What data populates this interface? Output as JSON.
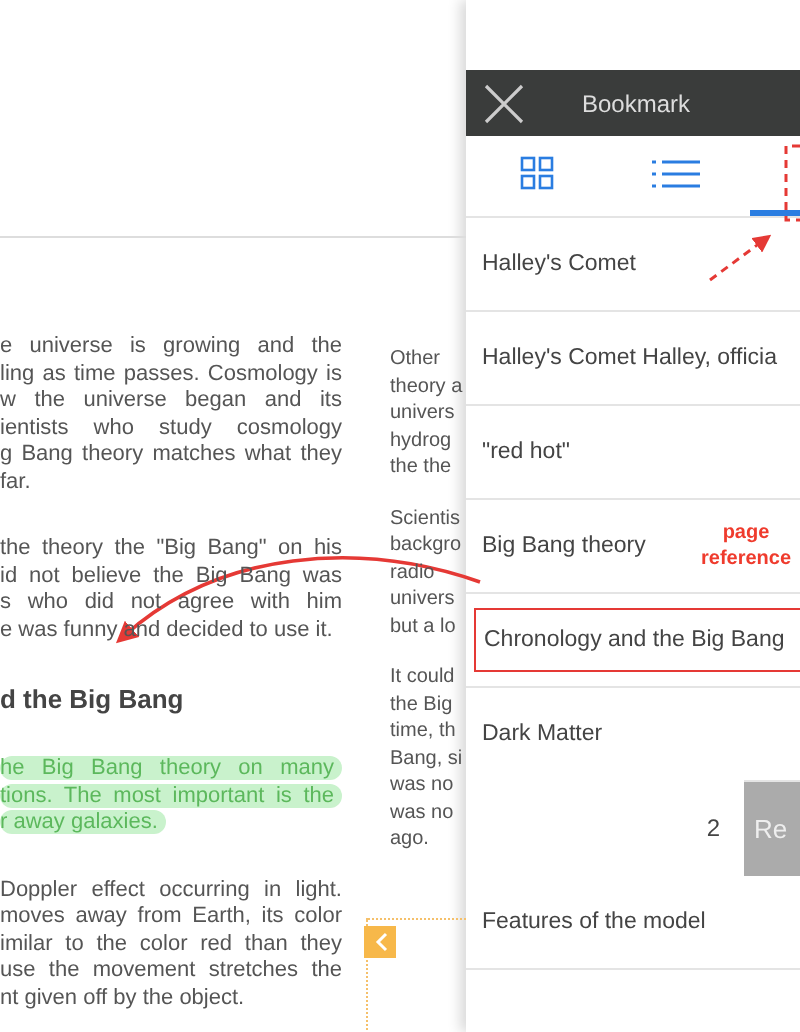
{
  "reader": {
    "columns": [
      {
        "blocks": [
          {
            "kind": "paragraph",
            "lines": [
              "e universe is growing and the",
              "ling as time passes. Cosmology is",
              "w the universe began and its",
              "ientists who study cosmology",
              "g Bang theory matches what they",
              "far."
            ]
          },
          {
            "kind": "paragraph",
            "lines": [
              "the theory the \"Big Bang\" on his",
              "id not believe the Big Bang was",
              "s who did not agree with him",
              "e was funny and decided to use it."
            ]
          },
          {
            "kind": "heading",
            "lines": [
              "d the Big Bang"
            ]
          },
          {
            "kind": "highlight",
            "lines": [
              "he Big Bang theory on many",
              "tions. The most important is the",
              "r away galaxies."
            ]
          },
          {
            "kind": "paragraph",
            "lines": [
              "Doppler effect occurring in light.",
              "moves away from Earth, its color",
              "imilar to the color red than they",
              "use the movement stretches the",
              "nt given off by the object."
            ]
          }
        ]
      },
      {
        "blocks": [
          {
            "kind": "paragraph",
            "lines": [
              "Other",
              "theory a",
              "univers",
              "hydrog",
              "the the"
            ]
          },
          {
            "kind": "paragraph",
            "lines": [
              "Scientis",
              "backgro",
              "radio",
              "univers",
              "but a lo"
            ]
          },
          {
            "kind": "paragraph",
            "lines": [
              "It could",
              "the Big",
              "time, th",
              "Bang, si",
              "was no",
              "was no",
              "ago."
            ]
          }
        ]
      }
    ]
  },
  "panel": {
    "title": "Bookmark",
    "tabs": [
      {
        "kind": "grid",
        "selected": false
      },
      {
        "kind": "list",
        "selected": false
      },
      {
        "kind": "other",
        "selected": true
      }
    ],
    "rows": [
      {
        "kind": "item",
        "label": "Halley's Comet",
        "boxed": false
      },
      {
        "kind": "item",
        "label": "Halley's Comet Halley, officia",
        "boxed": false
      },
      {
        "kind": "item",
        "label": "\"red hot\"",
        "boxed": false
      },
      {
        "kind": "item",
        "label": "Big Bang theory",
        "boxed": false,
        "note": "page reference"
      },
      {
        "kind": "item",
        "label": "Chronology and the Big Bang",
        "boxed": true
      },
      {
        "kind": "item",
        "label": "Dark Matter",
        "boxed": false
      },
      {
        "kind": "page_input",
        "value": "2",
        "button": "Re"
      },
      {
        "kind": "item",
        "label": "Features of the model",
        "boxed": false
      }
    ]
  }
}
